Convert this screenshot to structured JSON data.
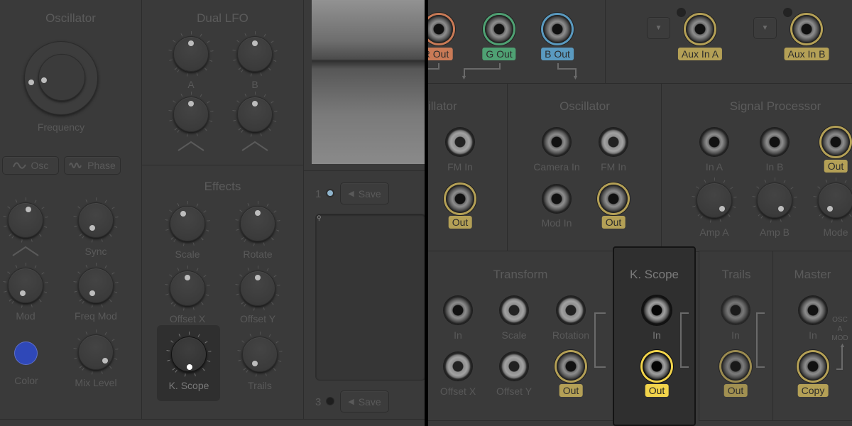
{
  "left": {
    "oscillator": {
      "title": "Oscillator",
      "frequency_label": "Frequency",
      "osc_button": "Osc",
      "phase_button": "Phase",
      "knobs": [
        {
          "label": "",
          "value": 0.5
        },
        {
          "label": "Sync",
          "value": 0.2
        },
        {
          "label": "Mod",
          "value": 0.15
        },
        {
          "label": "Freq Mod",
          "value": 0.2
        },
        {
          "label": "Mix Level",
          "value": 0.8
        }
      ],
      "color_label": "Color",
      "color_value": "#2f48b8"
    },
    "dual_lfo": {
      "title": "Dual LFO",
      "label_a": "A",
      "label_b": "B"
    },
    "effects": {
      "title": "Effects",
      "knobs": [
        {
          "label": "Scale"
        },
        {
          "label": "Rotate"
        },
        {
          "label": "Offset X"
        },
        {
          "label": "Offset Y"
        },
        {
          "label": "K. Scope"
        },
        {
          "label": "Trails"
        }
      ]
    },
    "presets": [
      {
        "number": "1",
        "save": "Save",
        "indicator_color": "#8fb4cc"
      },
      {
        "number": "3",
        "save": "Save",
        "indicator_color": "#1e1e1e"
      }
    ]
  },
  "right": {
    "outputs": [
      {
        "label": "R Out",
        "color": "#c97a56"
      },
      {
        "label": "G Out",
        "color": "#4fa173"
      },
      {
        "label": "B Out",
        "color": "#5a9ac0"
      }
    ],
    "aux": [
      {
        "label": "Aux In A"
      },
      {
        "label": "Aux In B"
      }
    ],
    "oscillator_partial": {
      "title": "illator",
      "fm_in": "FM In",
      "out": "Out"
    },
    "oscillator": {
      "title": "Oscillator",
      "camera_in": "Camera In",
      "fm_in": "FM In",
      "mod_in": "Mod In",
      "out": "Out"
    },
    "signal_processor": {
      "title": "Signal Processor",
      "in_a": "In A",
      "in_b": "In B",
      "out": "Out",
      "amp_a": "Amp A",
      "amp_b": "Amp B",
      "mode": "Mode"
    },
    "transform": {
      "title": "Transform",
      "in": "In",
      "scale": "Scale",
      "rotation": "Rotation",
      "offset_x": "Offset X",
      "offset_y": "Offset Y",
      "out": "Out"
    },
    "kscope": {
      "title": "K. Scope",
      "in": "In",
      "out": "Out"
    },
    "trails": {
      "title": "Trails",
      "in": "In",
      "out": "Out"
    },
    "master": {
      "title": "Master",
      "in": "In",
      "copy": "Copy",
      "side_label_1": "OSC",
      "side_label_2": "A",
      "side_label_3": "MOD"
    }
  }
}
